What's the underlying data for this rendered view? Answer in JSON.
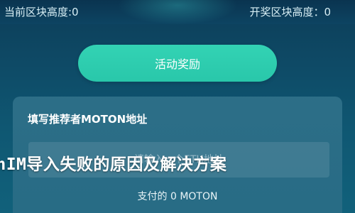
{
  "header": {
    "left_stat": "当前区块高度:0",
    "right_stat": "开奖区块高度：0"
  },
  "activity": {
    "button_label": "活动奖励"
  },
  "referrer": {
    "title": "填写推荐者MOTON地址",
    "input_placeholder": "请输入一个ETH地址",
    "input_value": "",
    "fee_text": "支付的 0 MOTON"
  },
  "overlay": {
    "title": "enIM导入失败的原因及解决方案"
  },
  "colors": {
    "background": "#0e4a66",
    "accent_button": "#2fcfb0",
    "card": "#32738c"
  }
}
